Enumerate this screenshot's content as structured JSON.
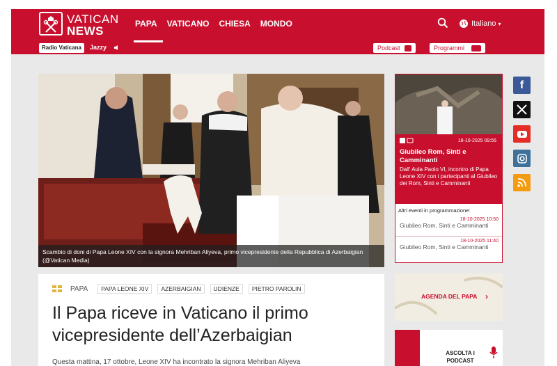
{
  "header": {
    "brand_line1": "VATICAN",
    "brand_line2": "NEWS",
    "nav": [
      "PAPA",
      "VATICANO",
      "CHIESA",
      "MONDO"
    ],
    "language": "Italiano",
    "radio_label": "Radio Vaticana",
    "radio_station": "Jazzy",
    "podcast_label": "Podcast",
    "programmi_label": "Programmi"
  },
  "hero": {
    "caption": "Scambio di doni di Papa Leone XIV con la signora Mehriban Aliyeva, primo vicepresidente della Repubblica di Azerbaigian  (@Vatican Media)"
  },
  "article": {
    "section": "PAPA",
    "tags": [
      "PAPA LEONE XIV",
      "AZERBAIGIAN",
      "UDIENZE",
      "PIETRO PAROLIN"
    ],
    "headline": "Il Papa riceve in Vaticano il primo vicepresidente dell’Azerbaigian",
    "lead": "Questa mattina, 17 ottobre, Leone XIV ha incontrato la signora Mehriban Aliyeva"
  },
  "live": {
    "date": "18-10-2025 09:55",
    "title": "Giubileo Rom, Sinti e Camminanti",
    "description": "Dall' Aula Paolo VI, incontro di Papa Leone XIV con i partecipanti al Giubileo dei Rom, Sinti e Camminanti",
    "other_heading": "Altri eventi in programmazione:",
    "events": [
      {
        "time": "18-10-2025 10:50",
        "title": "Giubileo Rom, Sinti e Camminanti"
      },
      {
        "time": "18-10-2025 11:40",
        "title": "Giubileo Rom, Sinti e Camminanti"
      }
    ]
  },
  "agenda_label": "AGENDA DEL PAPA",
  "podcast_box_label": "ASCOLTA I PODCAST",
  "social": [
    "facebook-icon",
    "x-icon",
    "youtube-icon",
    "instagram-icon",
    "rss-icon"
  ],
  "colors": {
    "brand_red": "#c8102e"
  }
}
